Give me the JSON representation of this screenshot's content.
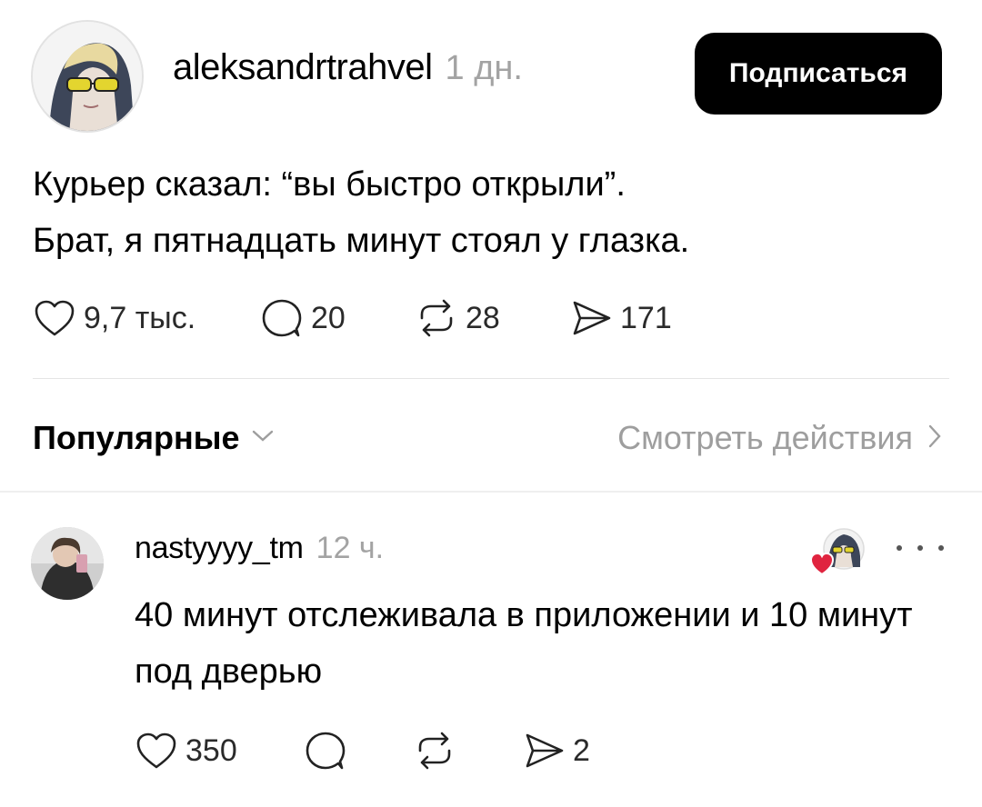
{
  "post": {
    "author": "aleksandrtrahvel",
    "time": "1 дн.",
    "follow_label": "Подписаться",
    "text_lines": [
      "Курьер сказал: “вы быстро открыли”.",
      "Брат, я пятнадцать минут стоял у глазка."
    ],
    "stats": {
      "likes": "9,7 тыс.",
      "replies": "20",
      "reposts": "28",
      "shares": "171"
    }
  },
  "sort": {
    "label": "Популярные",
    "activity_label": "Смотреть действия"
  },
  "reply": {
    "author": "nastyyyy_tm",
    "time": "12 ч.",
    "text": "40 минут отслеживала в приложении и 10 минут под дверью",
    "stats": {
      "likes": "350",
      "replies": "",
      "reposts": "",
      "shares": "2"
    }
  },
  "icons": {
    "like": "heart-outline-icon",
    "reply": "speech-bubble-icon",
    "repost": "repost-arrows-icon",
    "share": "paper-plane-icon",
    "chevron_down": "chevron-down-icon",
    "chevron_right": "chevron-right-icon",
    "more": "more-dots-icon",
    "liked_by": "red-heart-icon"
  },
  "colors": {
    "follow_button_bg": "#000000",
    "muted_text": "#a3a3a3",
    "liked_heart": "#e0243f"
  }
}
